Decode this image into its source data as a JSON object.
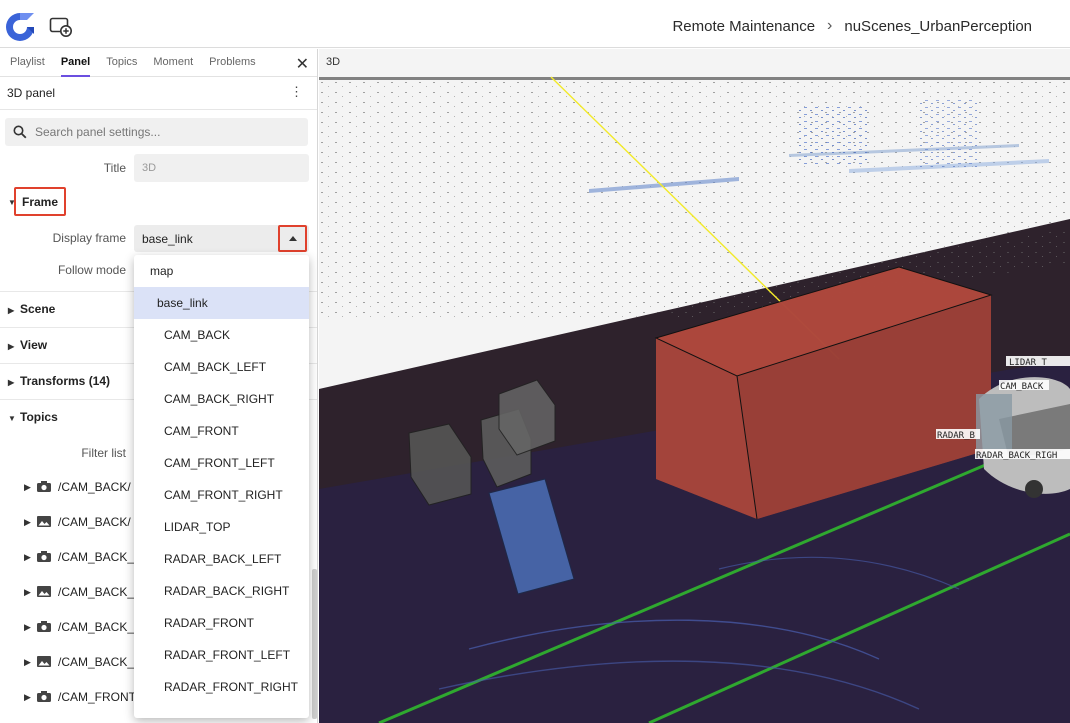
{
  "header": {
    "breadcrumb": [
      "Remote Maintenance",
      "nuScenes_UrbanPerception"
    ],
    "separator": "›"
  },
  "sidebar": {
    "tabs": [
      "Playlist",
      "Panel",
      "Topics",
      "Moment",
      "Problems"
    ],
    "active_tab": "Panel",
    "close_glyph": "✕",
    "panel_title": "3D panel",
    "menu_glyph": "⋮",
    "search_placeholder": "Search panel settings...",
    "title_label": "Title",
    "title_value": "3D",
    "frame_section": "Frame",
    "display_frame_label": "Display frame",
    "display_frame_value": "base_link",
    "follow_mode_label": "Follow mode",
    "sections": [
      "Scene",
      "View",
      "Transforms (14)",
      "Topics"
    ],
    "filter_label": "Filter list",
    "topics": [
      {
        "label": "/CAM_BACK/",
        "icon": "camera-icon"
      },
      {
        "label": "/CAM_BACK/",
        "icon": "image-icon"
      },
      {
        "label": "/CAM_BACK_",
        "icon": "camera-icon"
      },
      {
        "label": "/CAM_BACK_",
        "icon": "image-icon"
      },
      {
        "label": "/CAM_BACK_",
        "icon": "camera-icon"
      },
      {
        "label": "/CAM_BACK_",
        "icon": "image-icon"
      },
      {
        "label": "/CAM_FRONT",
        "icon": "camera-icon"
      }
    ]
  },
  "dropdown": {
    "options": [
      "map",
      "base_link",
      "CAM_BACK",
      "CAM_BACK_LEFT",
      "CAM_BACK_RIGHT",
      "CAM_FRONT",
      "CAM_FRONT_LEFT",
      "CAM_FRONT_RIGHT",
      "LIDAR_TOP",
      "RADAR_BACK_LEFT",
      "RADAR_BACK_RIGHT",
      "RADAR_FRONT",
      "RADAR_FRONT_LEFT",
      "RADAR_FRONT_RIGHT"
    ],
    "selected": "base_link"
  },
  "viewport": {
    "label": "3D",
    "scene_labels": [
      "CAM_BACK",
      "LIDAR_T",
      "RADAR_B",
      "RADAR_BACK_RIGH"
    ]
  },
  "colors": {
    "accent": "#6b4fe0",
    "highlight_box": "#e0412d",
    "selected_option": "#dbe2f7"
  }
}
